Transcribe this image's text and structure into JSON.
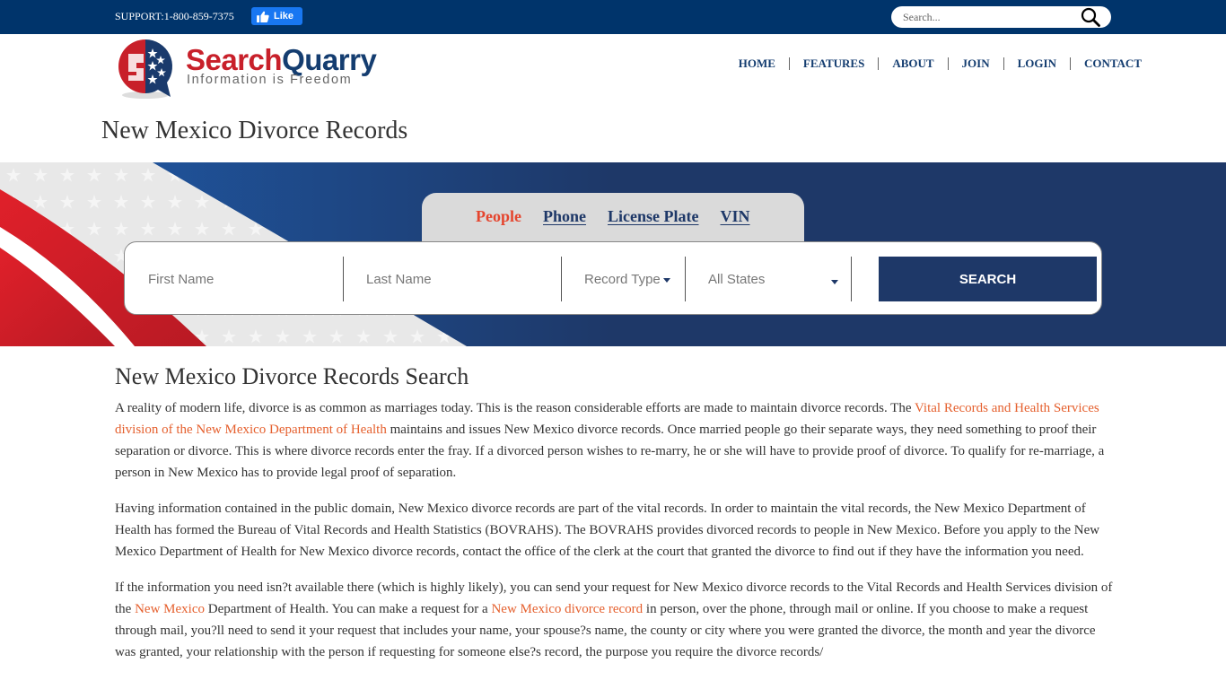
{
  "topbar": {
    "support_text": "SUPPORT:1-800-859-7375",
    "fb_like_label": "Like",
    "search_placeholder": "Search..."
  },
  "brand": {
    "name_part1": "Search",
    "name_part2": "Quarry",
    "tagline": "Information is Freedom",
    "colors": {
      "red": "#c8202a",
      "navy": "#143d70"
    }
  },
  "nav": {
    "items": [
      {
        "label": "HOME"
      },
      {
        "label": "FEATURES"
      },
      {
        "label": "ABOUT"
      },
      {
        "label": "JOIN"
      },
      {
        "label": "LOGIN"
      },
      {
        "label": "CONTACT"
      }
    ]
  },
  "page": {
    "title": "New Mexico Divorce Records"
  },
  "search_widget": {
    "tabs": [
      {
        "label": "People",
        "active": true
      },
      {
        "label": "Phone",
        "active": false
      },
      {
        "label": "License Plate",
        "active": false
      },
      {
        "label": "VIN",
        "active": false
      }
    ],
    "first_name_placeholder": "First Name",
    "last_name_placeholder": "Last Name",
    "record_type_label": "Record Type",
    "state_selected": "All States",
    "search_button": "SEARCH",
    "colors": {
      "active_tab": "#e5452e",
      "button": "#1e3868"
    }
  },
  "content": {
    "heading": "New Mexico Divorce Records Search",
    "p1": {
      "before": "A reality of modern life, divorce is as common as marriages today. This is the reason considerable efforts are made to maintain divorce records. The ",
      "link": "Vital Records and Health Services division of the New Mexico Department of Health",
      "after": " maintains and issues New Mexico divorce records. Once married people go their separate ways, they need something to proof their separation or divorce. This is where divorce records enter the fray. If a divorced person wishes to re-marry, he or she will have to provide proof of divorce. To qualify for re-marriage, a person in New Mexico has to provide legal proof of separation."
    },
    "p2": "Having information contained in the public domain, New Mexico divorce records are part of the vital records. In order to maintain the vital records, the New Mexico Department of Health has formed the Bureau of Vital Records and Health Statistics (BOVRAHS). The BOVRAHS provides divorced records to people in New Mexico. Before you apply to the New Mexico Department of Health for New Mexico divorce records, contact the office of the clerk at the court that granted the divorce to find out if they have the information you need.",
    "p3": {
      "part1": "If the information you need isn?t available there (which is highly likely), you can send your request for New Mexico divorce records to the Vital Records and Health Services division of the ",
      "link1": "New Mexico",
      "part2": " Department of Health. You can make a request for a ",
      "link2": "New Mexico divorce record",
      "part3": " in person, over the phone, through mail or online. If you choose to make a request through mail, you?ll need to send it your request that includes your name, your spouse?s name, the county or city where you were granted the divorce, the month and year the divorce was granted, your relationship with the person if requesting for someone else?s record, the purpose you require the divorce records/"
    },
    "link_color": "#e5602e"
  }
}
